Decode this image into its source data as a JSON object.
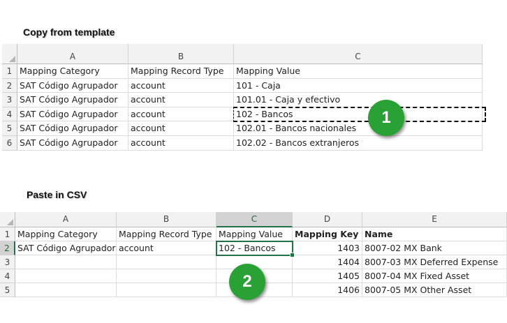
{
  "section1": {
    "title": "Copy from template",
    "columns": [
      "A",
      "B",
      "C"
    ],
    "rows": [
      {
        "num": "1",
        "cells": [
          "Mapping Category",
          "Mapping Record Type",
          "Mapping Value"
        ]
      },
      {
        "num": "2",
        "cells": [
          "SAT Código Agrupador",
          "account",
          "101 - Caja"
        ]
      },
      {
        "num": "3",
        "cells": [
          "SAT Código Agrupador",
          "account",
          "101.01 - Caja y efectivo"
        ]
      },
      {
        "num": "4",
        "cells": [
          "SAT Código Agrupador",
          "account",
          "102 - Bancos"
        ]
      },
      {
        "num": "5",
        "cells": [
          "SAT Código Agrupador",
          "account",
          "102.01 - Bancos nacionales"
        ]
      },
      {
        "num": "6",
        "cells": [
          "SAT Código Agrupador",
          "account",
          "102.02 - Bancos extranjeros"
        ]
      }
    ],
    "badge": "1"
  },
  "section2": {
    "title": "Paste in CSV",
    "columns": [
      "A",
      "B",
      "C",
      "D",
      "E"
    ],
    "rows": [
      {
        "num": "1",
        "cells": [
          "Mapping Category",
          "Mapping Record Type",
          "Mapping Value",
          "Mapping Key",
          "Name"
        ]
      },
      {
        "num": "2",
        "cells": [
          "SAT Código Agrupador",
          "account",
          "102 - Bancos",
          "1403",
          "8007-02 MX Bank"
        ]
      },
      {
        "num": "3",
        "cells": [
          "",
          "",
          "",
          "1404",
          "8007-03 MX Deferred Expense"
        ]
      },
      {
        "num": "4",
        "cells": [
          "",
          "",
          "",
          "1405",
          "8007-04 MX Fixed Asset"
        ]
      },
      {
        "num": "5",
        "cells": [
          "",
          "",
          "",
          "1406",
          "8007-05 MX Other Asset"
        ]
      }
    ],
    "badge": "2"
  },
  "colors": {
    "header_bg": "#f2f2f2",
    "active_header_bg": "#d3d3d3",
    "selection_border": "#217346",
    "badge_green": "#2aa135",
    "gridline": "#dcdcdc"
  }
}
